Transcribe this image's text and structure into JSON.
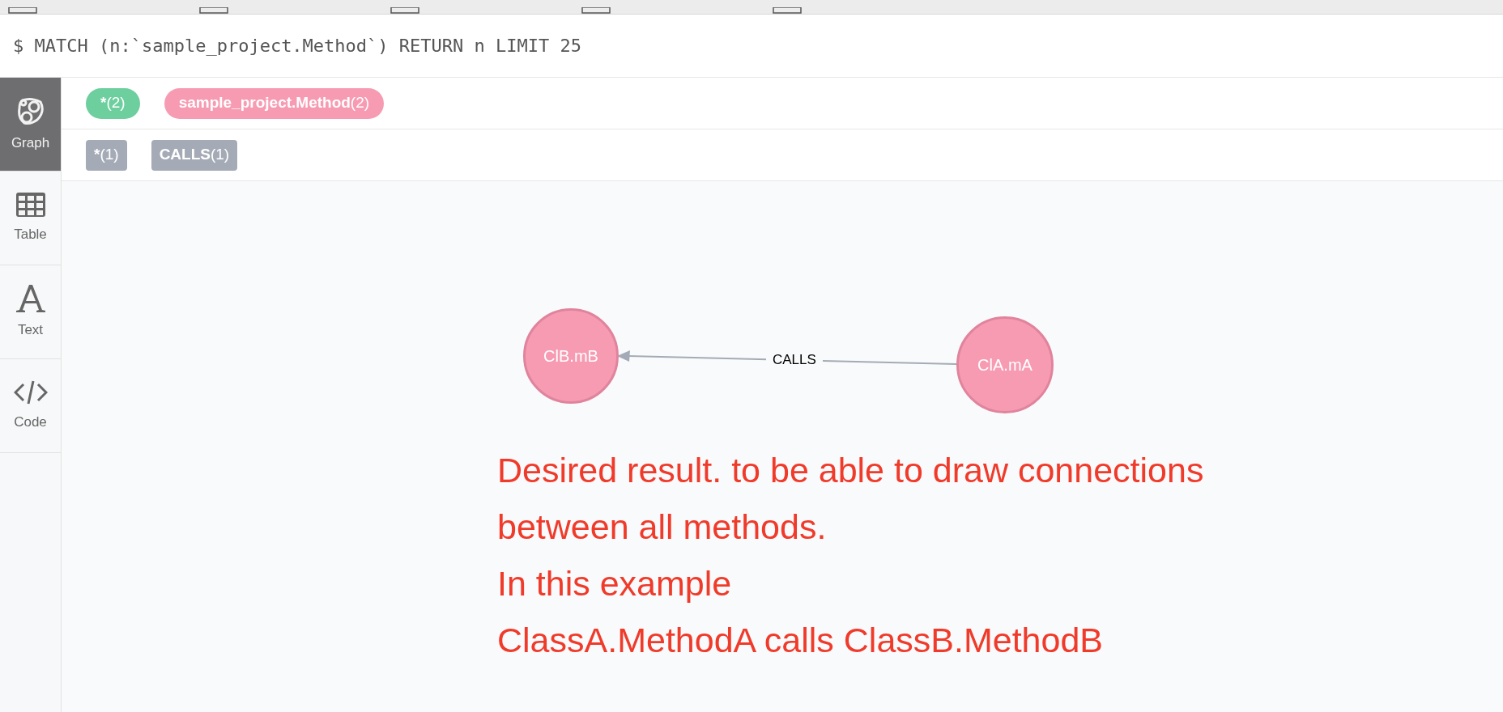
{
  "query": "$ MATCH (n:`sample_project.Method`) RETURN n LIMIT 25",
  "sidebar": [
    {
      "label": "Graph",
      "kind": "graph",
      "selected": true
    },
    {
      "label": "Table",
      "kind": "table",
      "selected": false
    },
    {
      "label": "Text",
      "kind": "text",
      "selected": false
    },
    {
      "label": "Code",
      "kind": "code",
      "selected": false
    }
  ],
  "node_labels": [
    {
      "name": "*",
      "count": "(2)",
      "color": "#6dce9e"
    },
    {
      "name": "sample_project.Method",
      "count": "(2)",
      "color": "#f79bb2"
    }
  ],
  "relationship_types": [
    {
      "name": "*",
      "count": "(1)"
    },
    {
      "name": "CALLS",
      "count": "(1)"
    }
  ],
  "graph": {
    "nodes": [
      {
        "caption": "ClB.mB"
      },
      {
        "caption": "ClA.mA"
      }
    ],
    "relationships": [
      {
        "type": "CALLS"
      }
    ]
  },
  "annotation": [
    "Desired result. to be able to draw connections",
    "between all methods.",
    "In this example",
    "ClassA.MethodA calls ClassB.MethodB"
  ]
}
